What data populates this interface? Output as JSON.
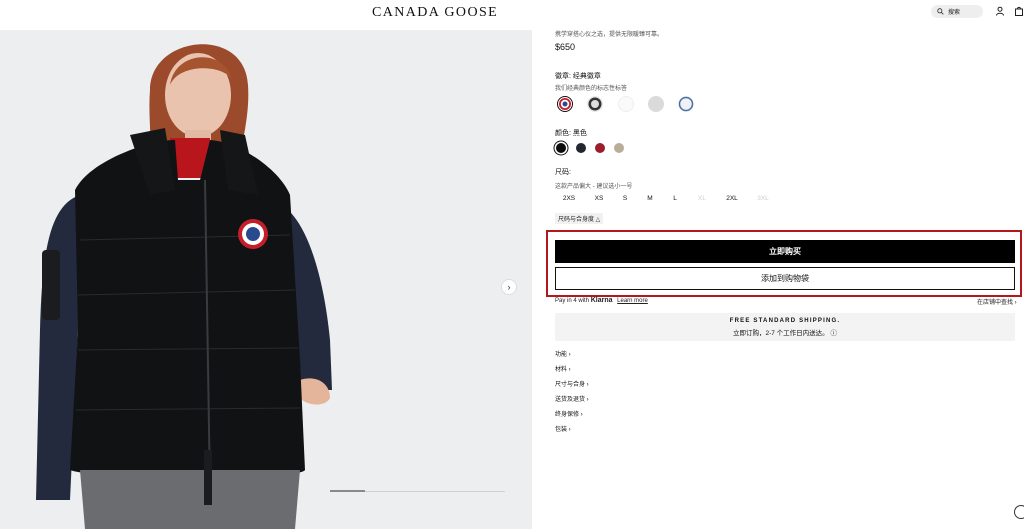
{
  "header": {
    "logo": "CANADA GOOSE",
    "search_label": "搜索"
  },
  "gallery": {
    "next_glyph": "›",
    "progress": 0.2
  },
  "product": {
    "description_tail": "携学穿搭心仪之选，提供无限暖臻可靠。",
    "price": "$650"
  },
  "badge_section": {
    "label": "徽章: 经典徽章",
    "sublabel": "我们经典颜色的标志性标答",
    "options": [
      "classic",
      "black-white",
      "white",
      "grey",
      "blue"
    ]
  },
  "color_section": {
    "label": "颜色: 黑色",
    "options": [
      "#0b0b0b",
      "#23262f",
      "#9c1d2b",
      "#b9ad98"
    ],
    "selected": 0
  },
  "size_section": {
    "label": "尺码:",
    "sublabel": "这款产品偏大 - 建议选小一号",
    "sizes": [
      "2XS",
      "XS",
      "S",
      "M",
      "L",
      "XL",
      "2XL",
      "3XL"
    ],
    "disabled": [
      "XL",
      "3XL"
    ],
    "guide_label": "尺码与合身度 △"
  },
  "actions": {
    "buy_now": "立即购买",
    "add_to_bag": "添加到购物袋",
    "highlight_color": "#b2171c"
  },
  "klarna": {
    "prefix": "Pay in 4 with",
    "brand": "Klarna",
    "learn_more": "Learn more",
    "store_link": "在店铺中查找 ›"
  },
  "shipping": {
    "title": "FREE STANDARD SHIPPING.",
    "subtitle": "立即订购，2-7 个工作日内送达。 ⓘ"
  },
  "accordion": [
    "功能 ›",
    "材料 ›",
    "尺寸与合身 ›",
    "送货及退货 ›",
    "终身保修 ›",
    "包装 ›"
  ]
}
